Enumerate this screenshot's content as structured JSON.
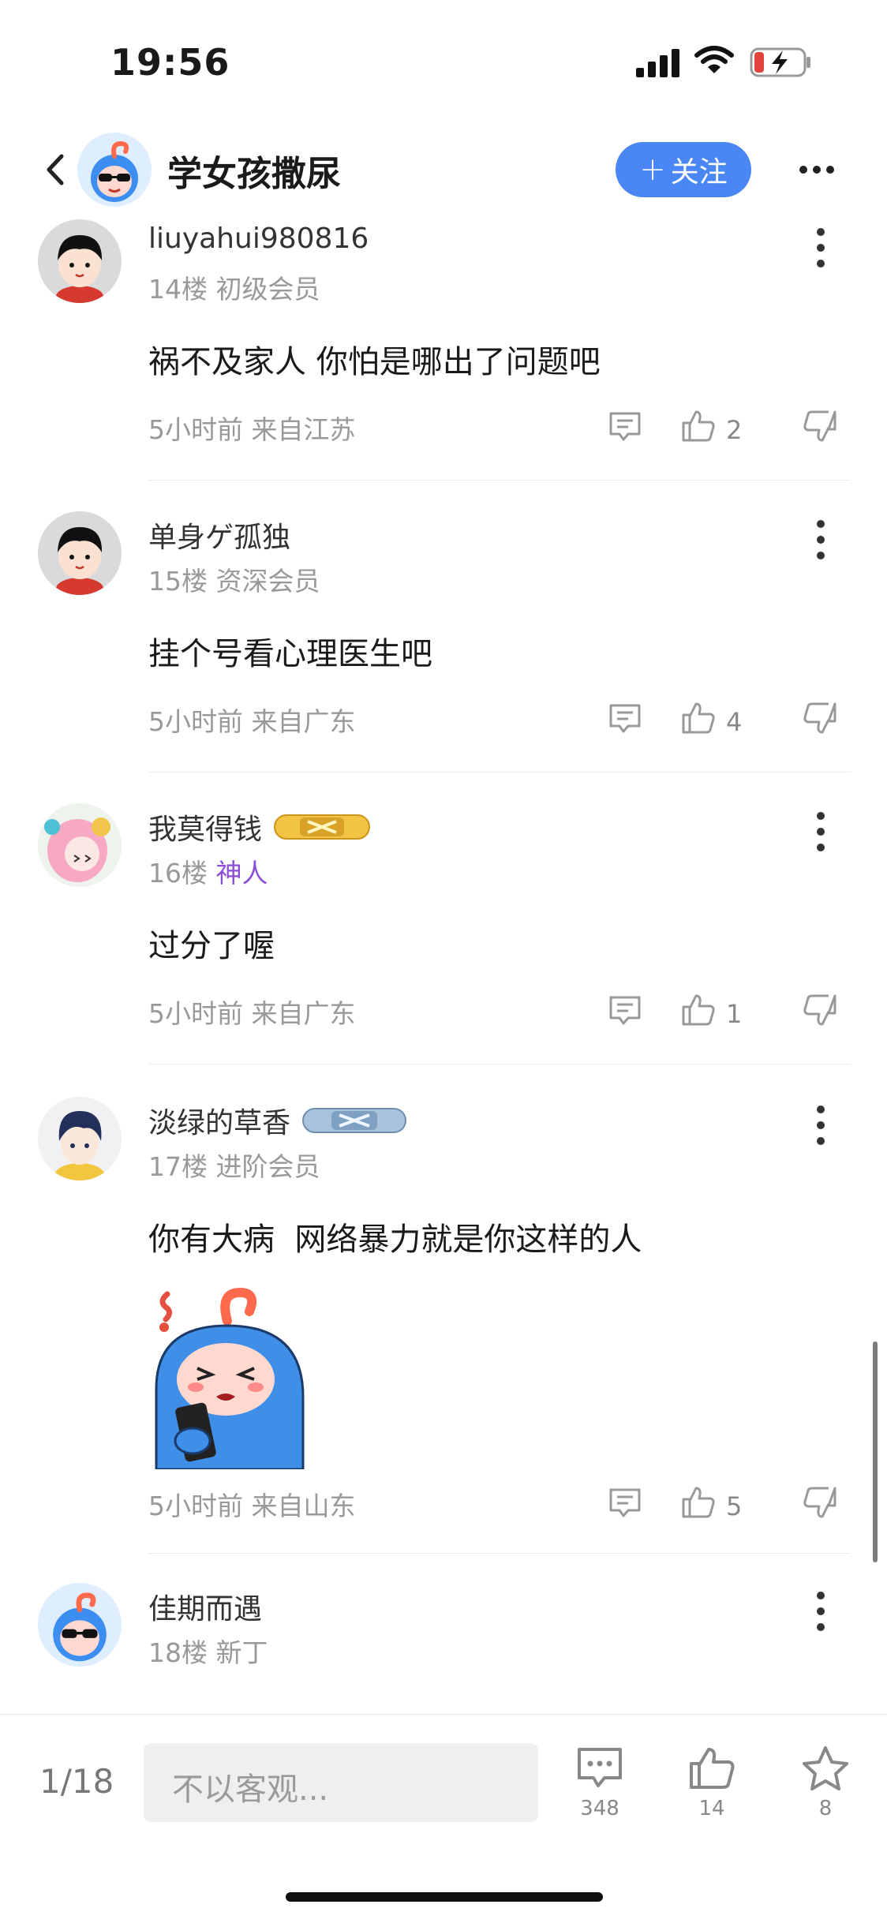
{
  "status": {
    "time": "19:56"
  },
  "header": {
    "forum_name": "学女孩撒尿",
    "follow_label": "关注",
    "follow_plus": "+"
  },
  "comments": [
    {
      "username": "liuyahui980816",
      "floor": "14楼",
      "level": "初级会员",
      "text": "祸不及家人 你怕是哪出了问题吧",
      "time": "5小时前",
      "location": "来自江苏",
      "likes": "2"
    },
    {
      "username": "单身ゲ孤独",
      "floor": "15楼",
      "level": "资深会员",
      "text": "挂个号看心理医生吧",
      "time": "5小时前",
      "location": "来自广东",
      "likes": "4"
    },
    {
      "username": "我莫得钱",
      "floor": "16楼",
      "level": "神人",
      "text": "过分了喔",
      "time": "5小时前",
      "location": "来自广东",
      "likes": "1"
    },
    {
      "username": "淡绿的草香",
      "floor": "17楼",
      "level": "进阶会员",
      "text": "你有大病  网络暴力就是你这样的人",
      "time": "5小时前",
      "location": "来自山东",
      "likes": "5"
    },
    {
      "username": "佳期而遇",
      "floor": "18楼",
      "level": "新丁"
    }
  ],
  "bottom_bar": {
    "page": "1/18",
    "placeholder": "不以客观...",
    "comment_count": "348",
    "like_count": "14",
    "star_count": "8"
  },
  "colors": {
    "accent": "#4a87f5",
    "level_purple": "#8a4fd6"
  }
}
